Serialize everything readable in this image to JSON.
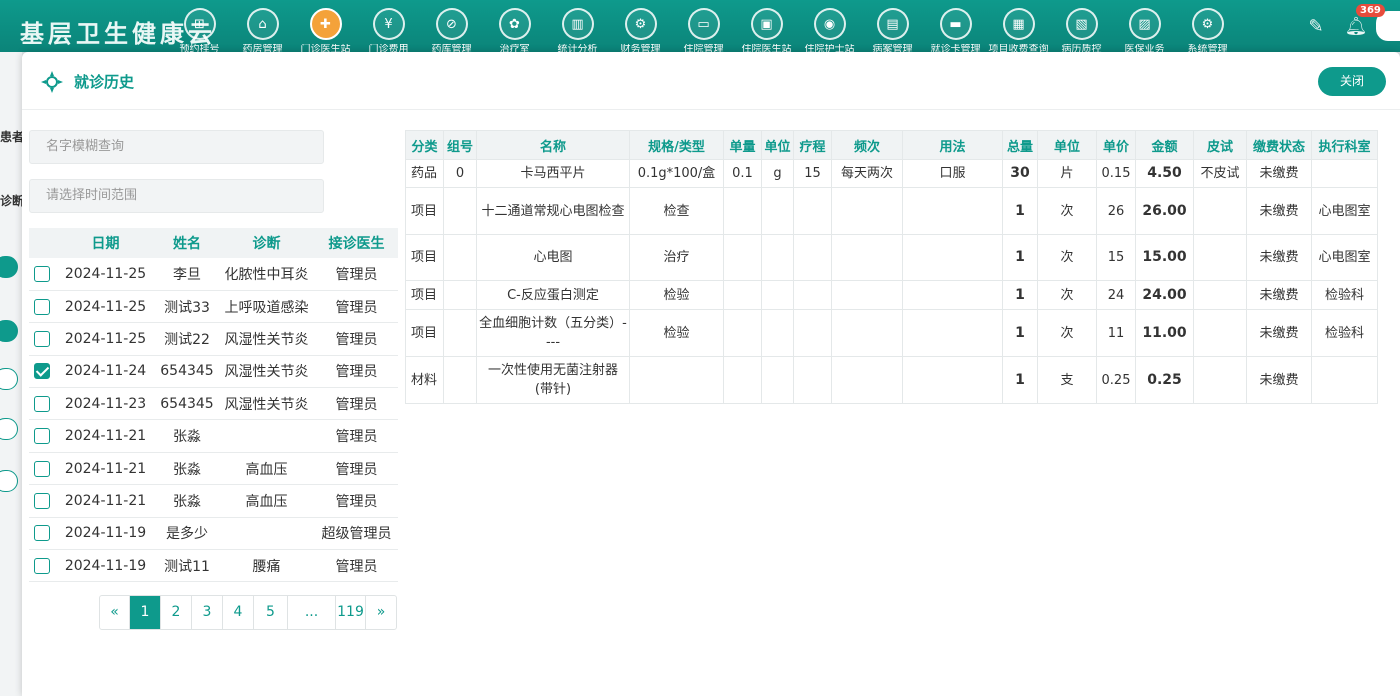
{
  "app": {
    "title": "基层卫生健康云"
  },
  "nav": [
    {
      "icon": "register-icon",
      "glyph": "⊞",
      "label": "预约挂号"
    },
    {
      "icon": "home-icon",
      "glyph": "⌂",
      "label": "药房管理"
    },
    {
      "icon": "doctor-icon",
      "glyph": "✚",
      "label": "门诊医生站",
      "active": true
    },
    {
      "icon": "yen-icon",
      "glyph": "¥",
      "label": "门诊费用"
    },
    {
      "icon": "capsule-icon",
      "glyph": "⊘",
      "label": "药库管理"
    },
    {
      "icon": "treatment-icon",
      "glyph": "✿",
      "label": "治疗室"
    },
    {
      "icon": "chart-icon",
      "glyph": "▥",
      "label": "统计分析"
    },
    {
      "icon": "gear-icon",
      "glyph": "⚙",
      "label": "财务管理"
    },
    {
      "icon": "bed-icon",
      "glyph": "▭",
      "label": "住院管理"
    },
    {
      "icon": "inpatient-doctor-icon",
      "glyph": "▣",
      "label": "住院医生站"
    },
    {
      "icon": "nurse-icon",
      "glyph": "◉",
      "label": "住院护士站"
    },
    {
      "icon": "ward-icon",
      "glyph": "▤",
      "label": "病案管理"
    },
    {
      "icon": "card-icon",
      "glyph": "▬",
      "label": "就诊卡管理"
    },
    {
      "icon": "fee-query-icon",
      "glyph": "▦",
      "label": "项目收费查询"
    },
    {
      "icon": "report-icon",
      "glyph": "▧",
      "label": "病历质控"
    },
    {
      "icon": "insurance-icon",
      "glyph": "▨",
      "label": "医保业务"
    },
    {
      "icon": "settings-icon",
      "glyph": "⚙",
      "label": "系统管理"
    }
  ],
  "notifications": {
    "count": "369"
  },
  "background": {
    "labels": [
      "患者",
      "诊断"
    ]
  },
  "modal": {
    "title": "就诊历史",
    "close_label": "关闭",
    "search_name_placeholder": "名字模糊查询",
    "search_time_placeholder": "请选择时间范围"
  },
  "visits": {
    "headers": {
      "date": "日期",
      "name": "姓名",
      "diagnosis": "诊断",
      "doctor": "接诊医生"
    },
    "rows": [
      {
        "checked": false,
        "date": "2024-11-25",
        "name": "李旦",
        "diagnosis": "化脓性中耳炎",
        "doctor": "管理员"
      },
      {
        "checked": false,
        "date": "2024-11-25",
        "name": "测试33",
        "diagnosis": "上呼吸道感染",
        "doctor": "管理员"
      },
      {
        "checked": false,
        "date": "2024-11-25",
        "name": "测试22",
        "diagnosis": "风湿性关节炎",
        "doctor": "管理员"
      },
      {
        "checked": true,
        "date": "2024-11-24",
        "name": "654345",
        "diagnosis": "风湿性关节炎",
        "doctor": "管理员"
      },
      {
        "checked": false,
        "date": "2024-11-23",
        "name": "654345",
        "diagnosis": "风湿性关节炎",
        "doctor": "管理员"
      },
      {
        "checked": false,
        "date": "2024-11-21",
        "name": "张淼",
        "diagnosis": "",
        "doctor": "管理员"
      },
      {
        "checked": false,
        "date": "2024-11-21",
        "name": "张淼",
        "diagnosis": "高血压",
        "doctor": "管理员"
      },
      {
        "checked": false,
        "date": "2024-11-21",
        "name": "张淼",
        "diagnosis": "高血压",
        "doctor": "管理员"
      },
      {
        "checked": false,
        "date": "2024-11-19",
        "name": "是多少",
        "diagnosis": "",
        "doctor": "超级管理员"
      },
      {
        "checked": false,
        "date": "2024-11-19",
        "name": "测试11",
        "diagnosis": "腰痛",
        "doctor": "管理员"
      }
    ]
  },
  "pagination": {
    "prev": "«",
    "pages": [
      "1",
      "2",
      "3",
      "4",
      "5",
      "...",
      "119"
    ],
    "current": "1",
    "next": "»"
  },
  "details": {
    "headers": [
      "分类",
      "组号",
      "名称",
      "规格/类型",
      "单量",
      "单位",
      "疗程",
      "频次",
      "用法",
      "总量",
      "单位",
      "单价",
      "金额",
      "皮试",
      "缴费状态",
      "执行科室"
    ],
    "rows": [
      {
        "category": "药品",
        "group": "0",
        "name": "卡马西平片",
        "spec": "0.1g*100/盒",
        "dose": "0.1",
        "dose_unit": "g",
        "course": "15",
        "frequency": "每天两次",
        "usage": "口服",
        "total": "30",
        "unit": "片",
        "price": "0.15",
        "amount": "4.50",
        "skin_test": "不皮试",
        "status": "未缴费",
        "dept": ""
      },
      {
        "category": "项目",
        "group": "",
        "name": "十二通道常规心电图检查",
        "spec": "检查",
        "dose": "",
        "dose_unit": "",
        "course": "",
        "frequency": "",
        "usage": "",
        "total": "1",
        "unit": "次",
        "price": "26",
        "amount": "26.00",
        "skin_test": "",
        "status": "未缴费",
        "dept": "心电图室"
      },
      {
        "category": "项目",
        "group": "",
        "name": "心电图",
        "spec": "治疗",
        "dose": "",
        "dose_unit": "",
        "course": "",
        "frequency": "",
        "usage": "",
        "total": "1",
        "unit": "次",
        "price": "15",
        "amount": "15.00",
        "skin_test": "",
        "status": "未缴费",
        "dept": "心电图室"
      },
      {
        "category": "项目",
        "group": "",
        "name": "C-反应蛋白测定",
        "spec": "检验",
        "dose": "",
        "dose_unit": "",
        "course": "",
        "frequency": "",
        "usage": "",
        "total": "1",
        "unit": "次",
        "price": "24",
        "amount": "24.00",
        "skin_test": "",
        "status": "未缴费",
        "dept": "检验科"
      },
      {
        "category": "项目",
        "group": "",
        "name": "全血细胞计数（五分类）----",
        "spec": "检验",
        "dose": "",
        "dose_unit": "",
        "course": "",
        "frequency": "",
        "usage": "",
        "total": "1",
        "unit": "次",
        "price": "11",
        "amount": "11.00",
        "skin_test": "",
        "status": "未缴费",
        "dept": "检验科"
      },
      {
        "category": "材料",
        "group": "",
        "name": "一次性使用无菌注射器(带针)",
        "spec": "",
        "dose": "",
        "dose_unit": "",
        "course": "",
        "frequency": "",
        "usage": "",
        "total": "1",
        "unit": "支",
        "price": "0.25",
        "amount": "0.25",
        "skin_test": "",
        "status": "未缴费",
        "dept": ""
      }
    ]
  }
}
